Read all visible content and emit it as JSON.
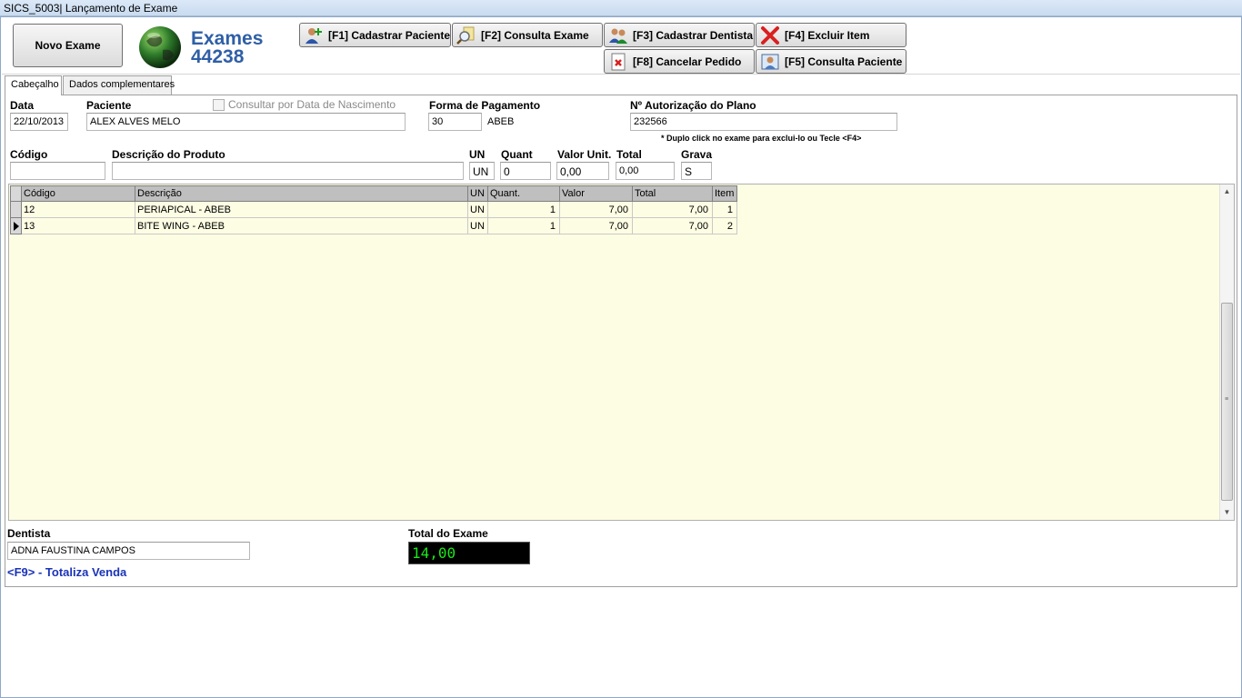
{
  "window": {
    "title": "SICS_5003| Lançamento de Exame"
  },
  "toolbar": {
    "novo_exame": "Novo Exame",
    "exam_label": "Exames",
    "exam_number": "44238",
    "f1": "[F1] Cadastrar Paciente",
    "f2": "[F2] Consulta Exame",
    "f3": "[F3] Cadastrar Dentista",
    "f4": "[F4] Excluir Item",
    "f8": "[F8] Cancelar Pedido",
    "f5": "[F5] Consulta Paciente"
  },
  "tabs": [
    "Cabeçalho",
    "Dados complementares"
  ],
  "header": {
    "data_label": "Data",
    "data_value": "22/10/2013",
    "paciente_label": "Paciente",
    "paciente_value": "ALEX ALVES MELO",
    "consultar_label": "Consultar por Data de Nascimento",
    "forma_label": "Forma de Pagamento",
    "forma_code": "30",
    "forma_name": "ABEB",
    "autorizacao_label": "Nº Autorização do Plano",
    "autorizacao_value": "232566",
    "hint": "* Duplo click no exame para exclui-lo ou Tecle <F4>"
  },
  "item_entry": {
    "codigo_label": "Código",
    "codigo_value": "",
    "descricao_label": "Descrição do Produto",
    "descricao_value": "",
    "un_label": "UN",
    "un_value": "UN",
    "quant_label": "Quant",
    "quant_value": "0",
    "valor_label": "Valor Unit.",
    "valor_value": "0,00",
    "total_label": "Total",
    "total_value": "0,00",
    "grava_label": "Grava",
    "grava_value": "S"
  },
  "grid": {
    "columns": [
      "Código",
      "Descrição",
      "UN",
      "Quant.",
      "Valor",
      "Total",
      "Item"
    ],
    "rows": [
      [
        "12",
        "PERIAPICAL - ABEB",
        "UN",
        "1",
        "7,00",
        "7,00",
        "1"
      ],
      [
        "13",
        "BITE WING - ABEB",
        "UN",
        "1",
        "7,00",
        "7,00",
        "2"
      ]
    ],
    "current_row": 2
  },
  "footer": {
    "dentista_label": "Dentista",
    "dentista_value": "ADNA FAUSTINA CAMPOS",
    "total_label": "Total do Exame",
    "total_value": "14,00",
    "f9": "<F9> - Totaliza Venda"
  },
  "colors": {
    "grid_bg": "#fdfde4",
    "total_fg": "#19e819",
    "f9_text": "#1a33b8",
    "title_blue": "#2f5fa6"
  }
}
